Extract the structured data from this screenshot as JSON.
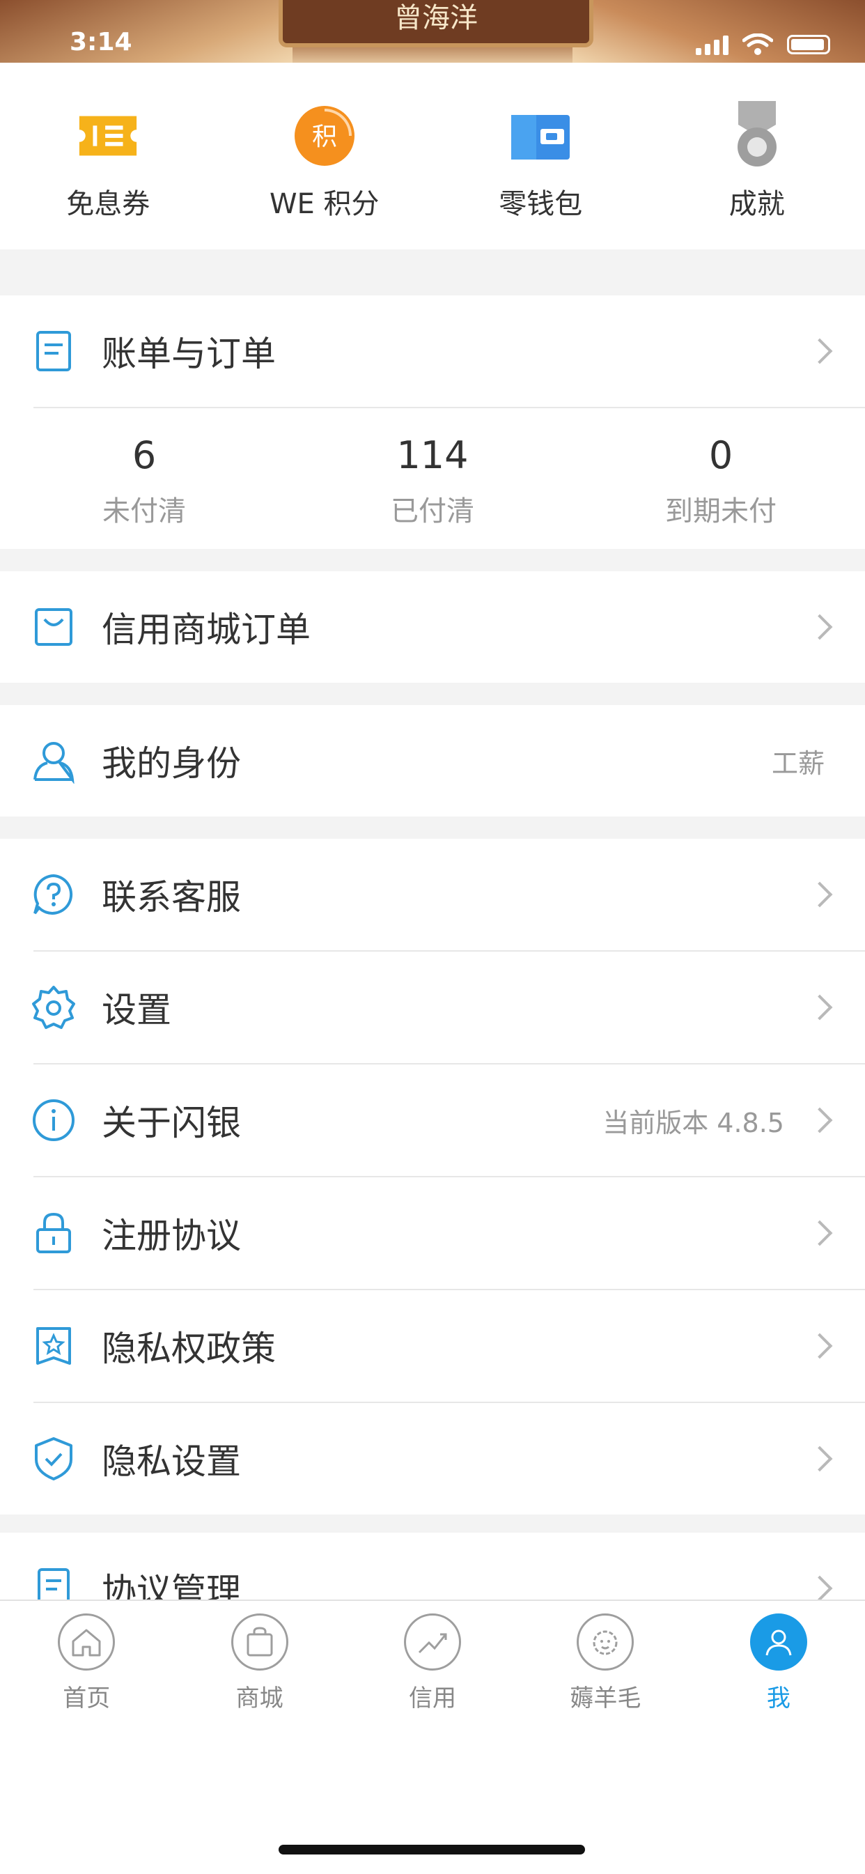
{
  "status": {
    "time": "3:14"
  },
  "banner": {
    "title": "曾海洋"
  },
  "quick": [
    {
      "label": "免息券",
      "icon": "coupon-icon"
    },
    {
      "label": "WE 积分",
      "icon": "points-icon",
      "badge": "积"
    },
    {
      "label": "零钱包",
      "icon": "wallet-icon"
    },
    {
      "label": "成就",
      "icon": "medal-icon"
    }
  ],
  "orders": {
    "title": "账单与订单",
    "stats": [
      {
        "value": "6",
        "label": "未付清"
      },
      {
        "value": "114",
        "label": "已付清"
      },
      {
        "value": "0",
        "label": "到期未付"
      }
    ]
  },
  "mall_orders": {
    "title": "信用商城订单"
  },
  "identity": {
    "title": "我的身份",
    "value": "工薪"
  },
  "menu": [
    {
      "title": "联系客服",
      "icon": "help-icon"
    },
    {
      "title": "设置",
      "icon": "gear-icon"
    },
    {
      "title": "关于闪银",
      "icon": "info-icon",
      "value": "当前版本 4.8.5"
    },
    {
      "title": "注册协议",
      "icon": "lock-icon"
    },
    {
      "title": "隐私权政策",
      "icon": "star-badge-icon"
    },
    {
      "title": "隐私设置",
      "icon": "shield-check-icon"
    }
  ],
  "agreement": {
    "title": "协议管理"
  },
  "tabs": [
    {
      "label": "首页",
      "icon": "home-icon"
    },
    {
      "label": "商城",
      "icon": "bag-icon"
    },
    {
      "label": "信用",
      "icon": "trend-icon"
    },
    {
      "label": "薅羊毛",
      "icon": "sheep-icon"
    },
    {
      "label": "我",
      "icon": "person-icon",
      "active": true
    }
  ],
  "colors": {
    "accent": "#1a9be6",
    "icon_blue": "#2f9ad8",
    "coupon": "#f6b21a",
    "points": "#f5901e",
    "wallet": "#3a8ee6",
    "medal": "#9e9e9e"
  }
}
